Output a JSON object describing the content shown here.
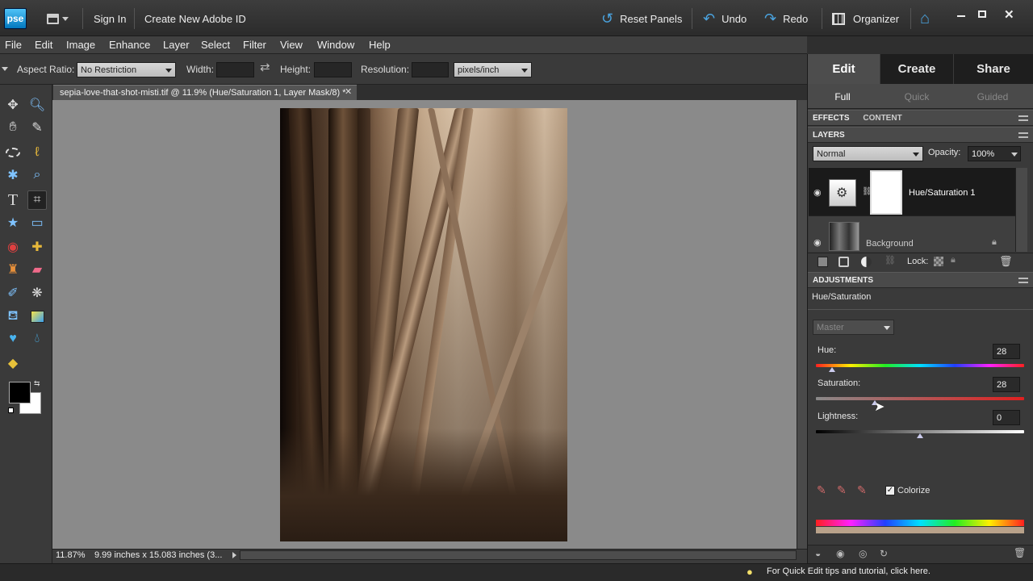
{
  "app": {
    "logo": "pse",
    "sign_in": "Sign In",
    "create_id": "Create New Adobe ID",
    "reset_panels": "Reset Panels",
    "undo": "Undo",
    "redo": "Redo",
    "organizer": "Organizer"
  },
  "menu": [
    "File",
    "Edit",
    "Image",
    "Enhance",
    "Layer",
    "Select",
    "Filter",
    "View",
    "Window",
    "Help"
  ],
  "options": {
    "aspect_label": "Aspect Ratio:",
    "aspect_value": "No Restriction",
    "width_label": "Width:",
    "height_label": "Height:",
    "resolution_label": "Resolution:",
    "units_value": "pixels/inch"
  },
  "document": {
    "tab_title": "sepia-love-that-shot-misti.tif @ 11.9% (Hue/Saturation 1, Layer Mask/8) *",
    "zoom": "11.87%",
    "doc_size": "9.99 inches x 15.083 inches (3..."
  },
  "panel": {
    "tabs": [
      "Edit",
      "Create",
      "Share"
    ],
    "subtabs": [
      "Full",
      "Quick",
      "Guided"
    ],
    "effects_tab": "EFFECTS",
    "content_tab": "CONTENT",
    "layers_title": "LAYERS",
    "blend_mode": "Normal",
    "opacity_label": "Opacity:",
    "opacity_value": "100%",
    "layers": [
      {
        "name": "Hue/Saturation 1"
      },
      {
        "name": "Background"
      }
    ],
    "lock_label": "Lock:",
    "adjustments_title": "ADJUSTMENTS",
    "adjustment_name": "Hue/Saturation",
    "channel": "Master",
    "hue_label": "Hue:",
    "hue_value": "28",
    "saturation_label": "Saturation:",
    "saturation_value": "28",
    "lightness_label": "Lightness:",
    "lightness_value": "0",
    "colorize_label": "Colorize",
    "colorize_checked": true
  },
  "tip": "For Quick Edit tips and tutorial, click here.",
  "colors": {
    "foreground": "#000000",
    "background": "#ffffff",
    "accent_blue": "#4aa3df"
  }
}
